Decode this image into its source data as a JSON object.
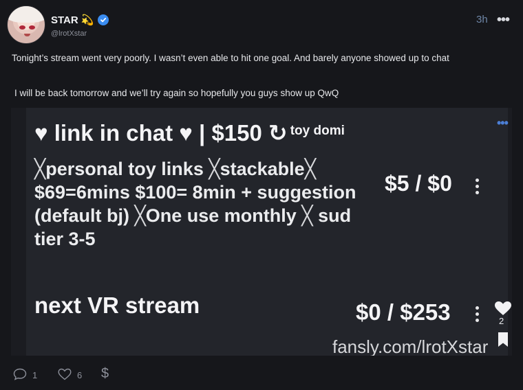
{
  "post": {
    "display_name": "STAR",
    "display_emoji": "💫",
    "handle": "@lrotXstar",
    "time": "3h",
    "text_line1": "Tonight’s stream went very poorly. I wasn’t even able to hit one goal. And barely anyone showed up to chat",
    "text_line2": "I will be back tomorrow and we’ll try again so hopefully you guys show up QwQ"
  },
  "media": {
    "title_main": "♥ link in chat ♥ | $150 ↻",
    "title_small": "toy domi",
    "desc_l1a": "personal toy links ",
    "desc_l1b": "stackable",
    "desc_l2": "$69=6mins $100= 8min + suggestion",
    "desc_l3a": "(default bj) ",
    "desc_l3b": "One use monthly ",
    "desc_l3c": " sud",
    "desc_l4": "tier 3-5",
    "price1": "$5 / $0",
    "vr_label": "next VR stream",
    "price2": "$0 / $253",
    "watermark": "fansly.com/lrotXstar"
  },
  "side_actions": {
    "likes": "2"
  },
  "footer": {
    "comments": "1",
    "likes": "6"
  },
  "colors": {
    "accent": "#3a8cf0",
    "background": "#16171b",
    "time": "#6f87a8"
  },
  "icons": [
    "verified-icon",
    "more-icon",
    "heart-icon",
    "bookmark-icon",
    "comment-icon",
    "dollar-icon"
  ]
}
